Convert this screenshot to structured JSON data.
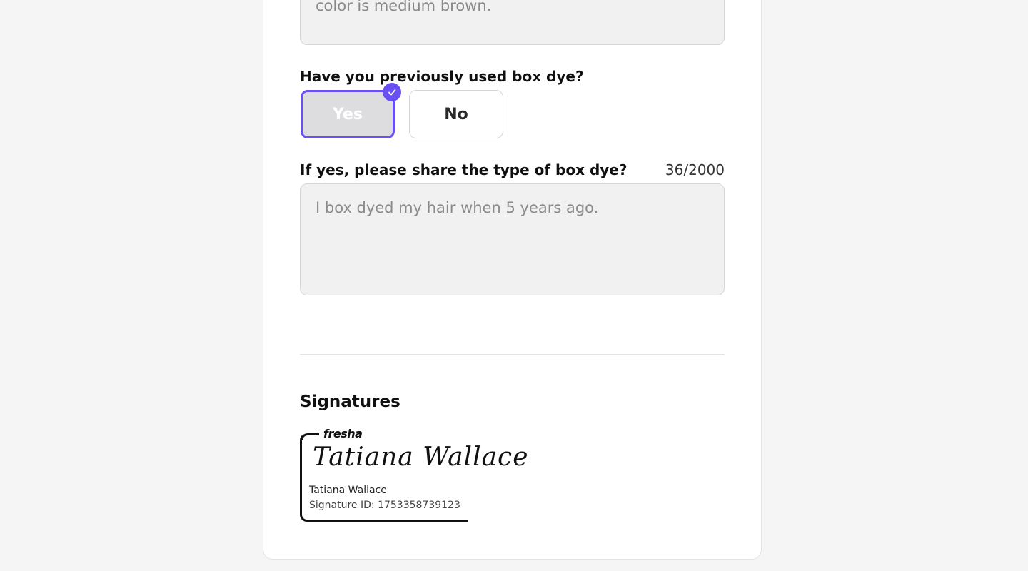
{
  "previous_answer": {
    "value": "color is medium brown."
  },
  "box_dye_question": {
    "label": "Have you previously used box dye?",
    "options": [
      "Yes",
      "No"
    ],
    "selected": "Yes",
    "accent_color": "#6950f3"
  },
  "box_dye_type": {
    "label": "If yes, please share the type of box dye?",
    "counter": "36/2000",
    "value": "I box dyed my hair when 5 years ago."
  },
  "signatures": {
    "title": "Signatures",
    "brand": "fresha",
    "script_name": "Tatiana Wallace",
    "name": "Tatiana Wallace",
    "signature_id": "Signature ID: 1753358739123"
  }
}
